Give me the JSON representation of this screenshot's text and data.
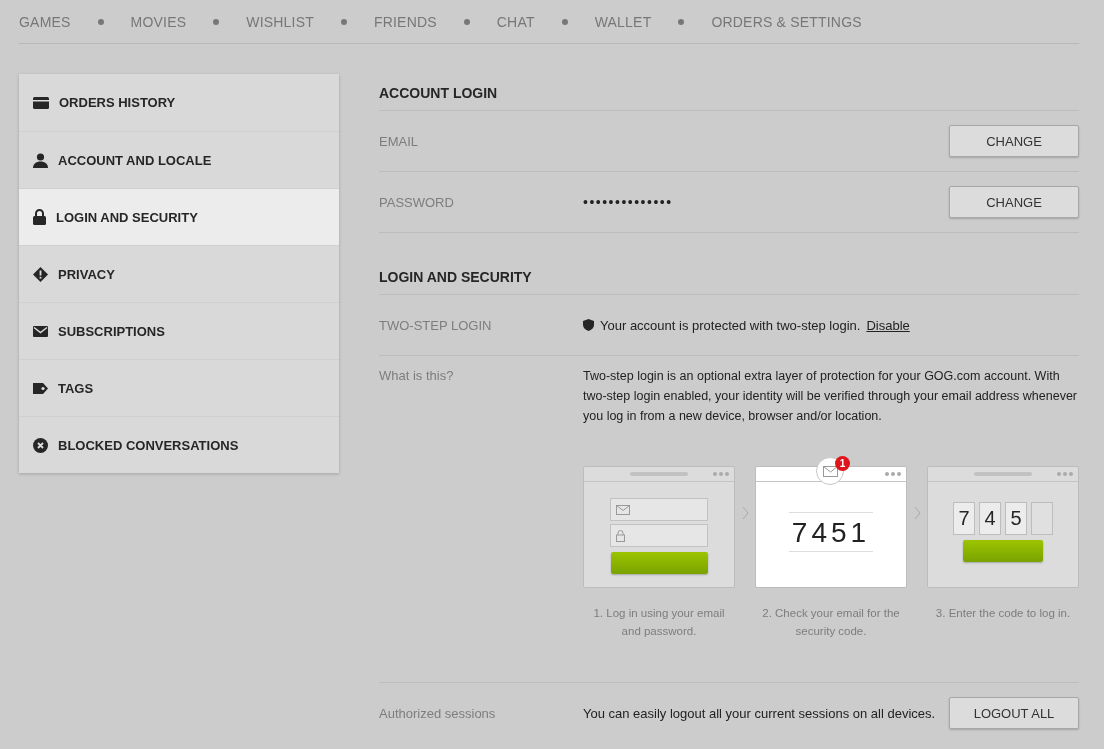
{
  "nav": [
    {
      "label": "GAMES"
    },
    {
      "label": "MOVIES"
    },
    {
      "label": "WISHLIST"
    },
    {
      "label": "FRIENDS"
    },
    {
      "label": "CHAT"
    },
    {
      "label": "WALLET"
    },
    {
      "label": "ORDERS & SETTINGS"
    }
  ],
  "sidebar": {
    "items": [
      {
        "label": "ORDERS HISTORY",
        "kind": "card",
        "selected": false
      },
      {
        "label": "ACCOUNT AND LOCALE",
        "kind": "user",
        "selected": false
      },
      {
        "label": "LOGIN AND SECURITY",
        "kind": "lock",
        "selected": true
      },
      {
        "label": "PRIVACY",
        "kind": "alert",
        "selected": false
      },
      {
        "label": "SUBSCRIPTIONS",
        "kind": "mail",
        "selected": false
      },
      {
        "label": "TAGS",
        "kind": "tag",
        "selected": false
      },
      {
        "label": "BLOCKED CONVERSATIONS",
        "kind": "blocked",
        "selected": false
      }
    ]
  },
  "account_login": {
    "title": "ACCOUNT LOGIN",
    "rows": [
      {
        "label": "EMAIL",
        "button": "CHANGE"
      },
      {
        "label": "PASSWORD",
        "value": "••••••••••••••",
        "button": "CHANGE"
      }
    ]
  },
  "login_security": {
    "title": "LOGIN AND SECURITY",
    "two_step": {
      "label": "TWO-STEP LOGIN",
      "text": "Your account is protected with two-step login.",
      "link": "Disable"
    },
    "what": {
      "label": "What is this?",
      "text": "Two-step login is an optional extra layer of protection for your GOG.com account. With two-step login enabled, your identity will be verified through your email address whenever you log in from a new device, browser and/or location.",
      "steps": [
        {
          "kind": "login",
          "caption": "1. Log in using your email and password."
        },
        {
          "kind": "email",
          "badge": "1",
          "code": "7451",
          "caption": "2. Check your email for the security code."
        },
        {
          "kind": "enter",
          "digits": [
            {
              "text": "7",
              "filled": true
            },
            {
              "text": "4",
              "filled": true
            },
            {
              "text": "5",
              "filled": true
            },
            {
              "filled": false
            }
          ],
          "caption": "3. Enter the code to log in."
        }
      ]
    },
    "sessions": {
      "label": "Authorized sessions",
      "text": "You can easily logout all your current sessions on all devices.",
      "button": "LOGOUT ALL"
    }
  }
}
